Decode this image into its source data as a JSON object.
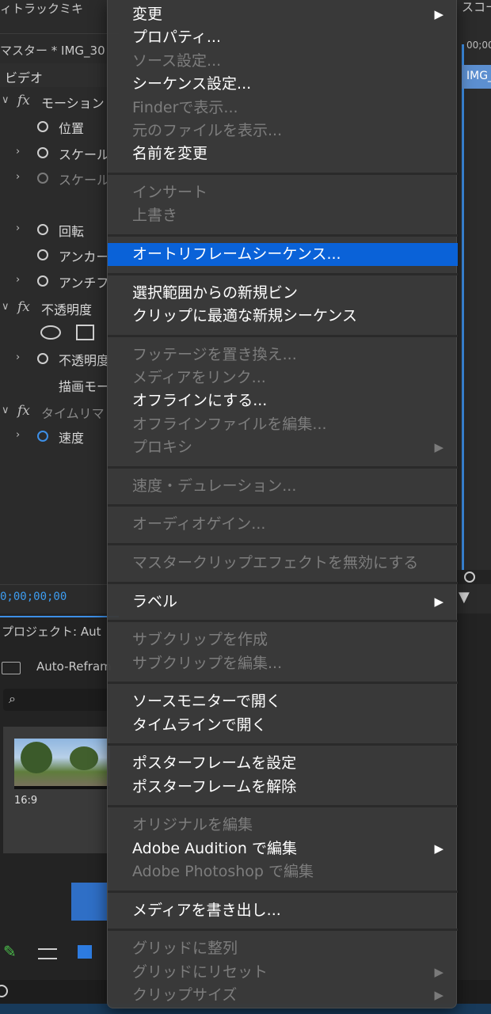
{
  "background_panel": {
    "top_title": "ィトラックミキ",
    "master_label": "マスター * IMG_30",
    "video_label": "ビデオ",
    "rows": [
      {
        "label": "モーション",
        "type": "fx",
        "expand": true
      },
      {
        "label": "位置",
        "type": "sw",
        "expand": false
      },
      {
        "label": "スケール",
        "type": "sw",
        "expand": true
      },
      {
        "label": "スケール",
        "type": "sw",
        "expand": true,
        "dim": true
      },
      {
        "label": "回転",
        "type": "sw",
        "expand": true
      },
      {
        "label": "アンカー",
        "type": "sw",
        "expand": false
      },
      {
        "label": "アンチフ",
        "type": "sw",
        "expand": true
      },
      {
        "label": "不透明度",
        "type": "fx",
        "expand": true
      },
      {
        "label": "不透明度",
        "type": "sw",
        "expand": true
      },
      {
        "label": "描画モー",
        "type": "plain",
        "expand": false
      },
      {
        "label": "タイムリマ",
        "type": "fx",
        "expand": true,
        "dim": true
      },
      {
        "label": "速度",
        "type": "sw-blue",
        "expand": true
      }
    ],
    "timecode": "0;00;00;00",
    "right_top_label": "スコー",
    "right_timecode": "00;00",
    "right_clip": "IMG_"
  },
  "project_panel": {
    "title": "プロジェクト: Aut",
    "folder": "Auto-Refram",
    "thumb_ratio": "16:9"
  },
  "colors": {
    "menu_bg": "#3a3a3a",
    "selected": "#0a62d8",
    "timecode": "#3d9cf0"
  },
  "context_menu": {
    "items": [
      {
        "label": "変更",
        "enabled": true,
        "submenu": true
      },
      {
        "label": "プロパティ...",
        "enabled": true
      },
      {
        "label": "ソース設定...",
        "enabled": false
      },
      {
        "label": "シーケンス設定...",
        "enabled": true
      },
      {
        "label": "Finderで表示...",
        "enabled": false
      },
      {
        "label": "元のファイルを表示...",
        "enabled": false
      },
      {
        "label": "名前を変更",
        "enabled": true
      },
      {
        "sep": true
      },
      {
        "label": "インサート",
        "enabled": false
      },
      {
        "label": "上書き",
        "enabled": false
      },
      {
        "sep": true
      },
      {
        "label": "オートリフレームシーケンス...",
        "enabled": true,
        "selected": true
      },
      {
        "sep": true
      },
      {
        "label": "選択範囲からの新規ビン",
        "enabled": true
      },
      {
        "label": "クリップに最適な新規シーケンス",
        "enabled": true
      },
      {
        "sep": true
      },
      {
        "label": "フッテージを置き換え...",
        "enabled": false
      },
      {
        "label": "メディアをリンク...",
        "enabled": false
      },
      {
        "label": "オフラインにする...",
        "enabled": true
      },
      {
        "label": "オフラインファイルを編集...",
        "enabled": false
      },
      {
        "label": "プロキシ",
        "enabled": false,
        "submenu": true
      },
      {
        "sep": true
      },
      {
        "label": "速度・デュレーション...",
        "enabled": false
      },
      {
        "sep": true
      },
      {
        "label": "オーディオゲイン...",
        "enabled": false
      },
      {
        "sep": true
      },
      {
        "label": "マスタークリップエフェクトを無効にする",
        "enabled": false
      },
      {
        "sep": true
      },
      {
        "label": "ラベル",
        "enabled": true,
        "submenu": true
      },
      {
        "sep": true
      },
      {
        "label": "サブクリップを作成",
        "enabled": false
      },
      {
        "label": "サブクリップを編集...",
        "enabled": false
      },
      {
        "sep": true
      },
      {
        "label": "ソースモニターで開く",
        "enabled": true
      },
      {
        "label": "タイムラインで開く",
        "enabled": true
      },
      {
        "sep": true
      },
      {
        "label": "ポスターフレームを設定",
        "enabled": true
      },
      {
        "label": "ポスターフレームを解除",
        "enabled": true
      },
      {
        "sep": true
      },
      {
        "label": "オリジナルを編集",
        "enabled": false
      },
      {
        "label": "Adobe Audition で編集",
        "enabled": true,
        "submenu": true
      },
      {
        "label": "Adobe Photoshop で編集",
        "enabled": false
      },
      {
        "sep": true
      },
      {
        "label": "メディアを書き出し...",
        "enabled": true
      },
      {
        "sep": true
      },
      {
        "label": "グリッドに整列",
        "enabled": false
      },
      {
        "label": "グリッドにリセット",
        "enabled": false,
        "submenu": true
      },
      {
        "label": "クリップサイズ",
        "enabled": false,
        "submenu": true
      }
    ]
  }
}
